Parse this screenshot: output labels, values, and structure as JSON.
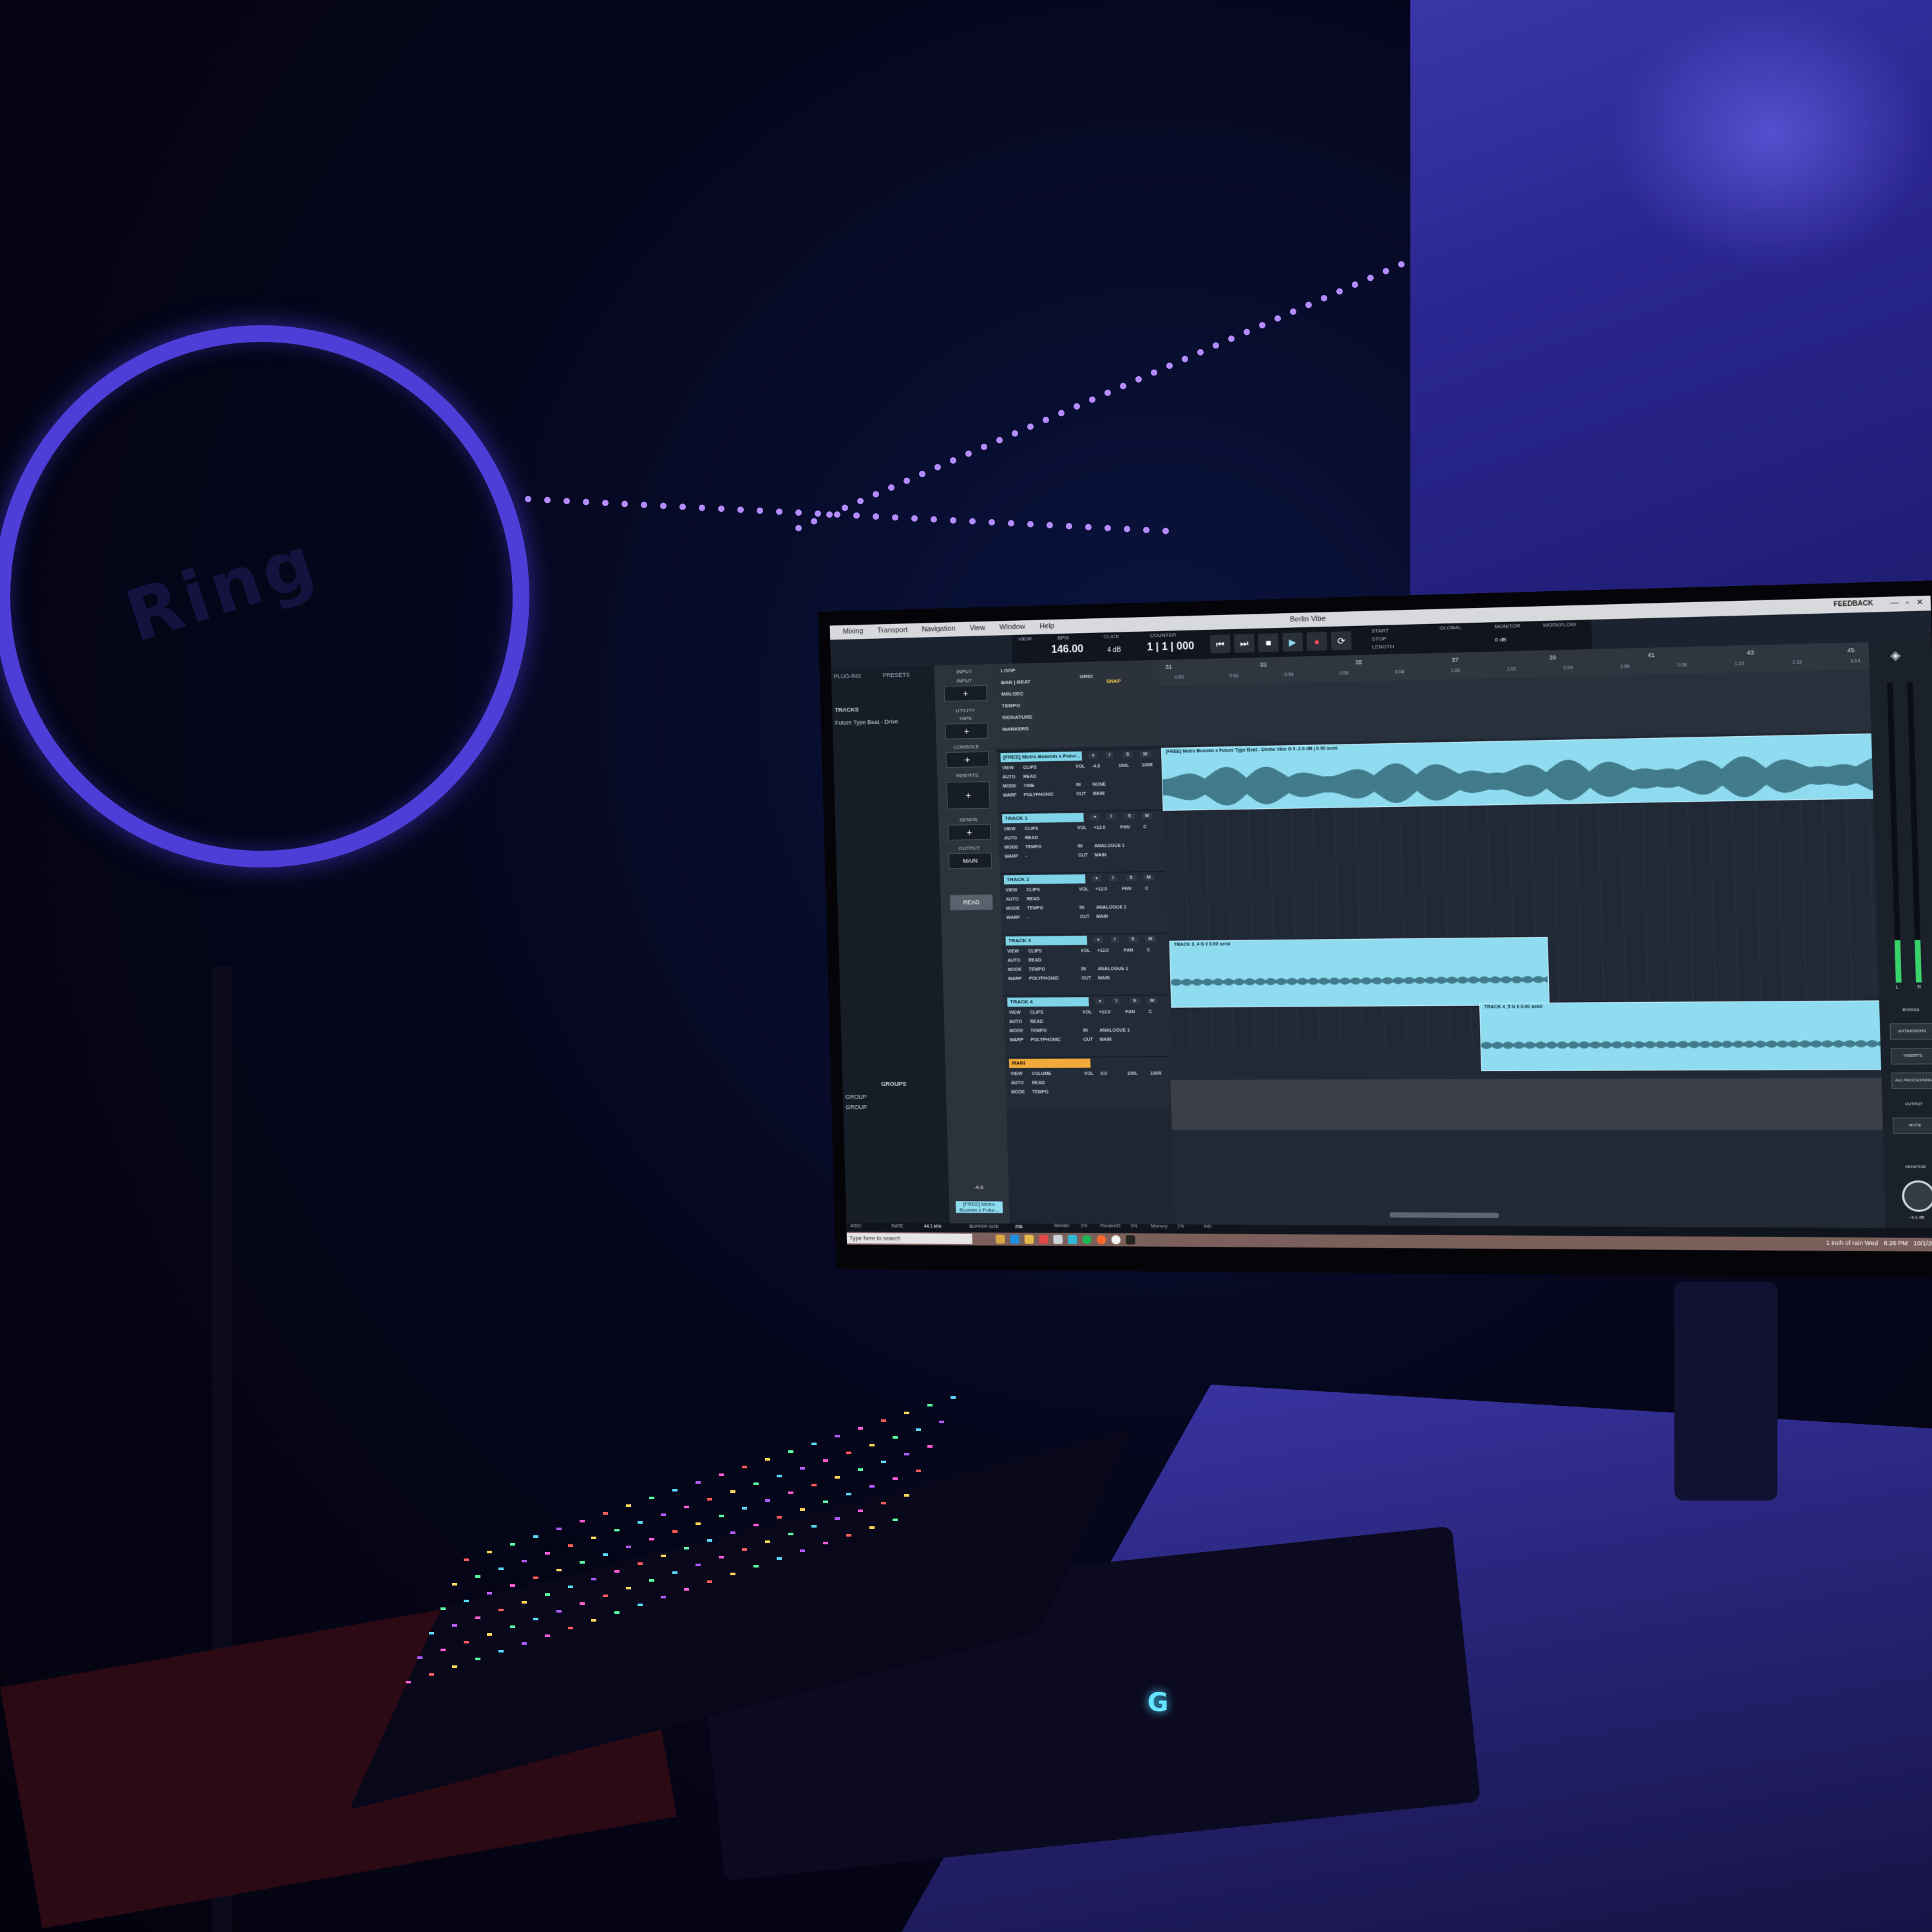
{
  "app": {
    "menus": [
      "Mixing",
      "Transport",
      "Navigation",
      "View",
      "Window",
      "Help"
    ],
    "project_title": "Berlin Vibe",
    "feedback_label": "FEEDBACK",
    "window_controls": [
      "—",
      "▫",
      "✕"
    ]
  },
  "transport": {
    "view_label": "VIEW",
    "bpm_label": "BPM",
    "bpm_value": "146.00",
    "click_label": "CLICK",
    "click_value": "4 dB",
    "counter_label": "COUNTER",
    "counter_value": "1 | 1 | 000",
    "buttons": [
      "⏮",
      "⏭",
      "■",
      "▶",
      "●",
      "⟳"
    ],
    "start_label": "START",
    "stop_label": "STOP",
    "length_label": "LENGTH",
    "global_label": "GLOBAL",
    "monitor_label": "MONITOR",
    "monitor_value": "0 dB",
    "workflow_label": "WORKFLOW"
  },
  "left_panel": {
    "tabs": [
      "PLUG-INS",
      "PRESETS"
    ],
    "section": "TRACKS",
    "item": "Future Type Beat - Drive",
    "groups_label": "GROUPS",
    "group_items": [
      "GROUP",
      "GROUP"
    ]
  },
  "mid_panel": {
    "labels": [
      "INPUT",
      "INPUT",
      "UTILITY",
      "TAPE",
      "CONSOLE",
      "INSERTS",
      "SENDS",
      "OUTPUT"
    ],
    "output_value": "MAIN",
    "read_label": "READ",
    "fader_value": "-4.0",
    "track_tag": "[FREE] Metro Boomin x Futur..."
  },
  "ruler_rows": [
    "LOOP",
    "BAR | BEAT",
    "MIN:SEC",
    "TEMPO",
    "SIGNATURE",
    "MARKERS"
  ],
  "grid": {
    "label": "GRID",
    "snap": "SNAP"
  },
  "bars": [
    "31",
    "33",
    "35",
    "37",
    "39",
    "41",
    "43",
    "45"
  ],
  "times": [
    "0:50",
    "0:52",
    "0:54",
    "0:56",
    "0:58",
    "1:00",
    "1:02",
    "1:04",
    "1:06",
    "1:08",
    "1:10",
    "1:12",
    "1:14"
  ],
  "tracks": [
    {
      "name": "[FREE] Metro Boomin x Futur...",
      "view": "CLIPS",
      "auto": "READ",
      "mode": "TIME",
      "warp": "POLYPHONIC",
      "vol": "-4.0",
      "pan": "100L",
      "pan2": "100R",
      "in": "NONE",
      "out": "MAIN"
    },
    {
      "name": "TRACK 1",
      "view": "CLIPS",
      "auto": "READ",
      "mode": "TEMPO",
      "warp": "-",
      "vol": "+12.0",
      "pan": "PAN",
      "pan2": "C",
      "in": "ANALOGUE 1",
      "out": "MAIN"
    },
    {
      "name": "TRACK 2",
      "view": "CLIPS",
      "auto": "READ",
      "mode": "TEMPO",
      "warp": "-",
      "vol": "+12.0",
      "pan": "PAN",
      "pan2": "C",
      "in": "ANALOGUE 1",
      "out": "MAIN"
    },
    {
      "name": "TRACK 3",
      "view": "CLIPS",
      "auto": "READ",
      "mode": "TEMPO",
      "warp": "POLYPHONIC",
      "vol": "+12.0",
      "pan": "PAN",
      "pan2": "C",
      "in": "ANALOGUE 1",
      "out": "MAIN"
    },
    {
      "name": "TRACK 4",
      "view": "CLIPS",
      "auto": "READ",
      "mode": "TEMPO",
      "warp": "POLYPHONIC",
      "vol": "+12.0",
      "pan": "PAN",
      "pan2": "C",
      "in": "ANALOGUE 1",
      "out": "MAIN"
    }
  ],
  "main_track": {
    "name": "MAIN",
    "view": "VOLUME",
    "auto": "READ",
    "mode": "TEMPO",
    "vol": "0.0",
    "pan": "100L",
    "pan2": "100R"
  },
  "track_buttons": [
    "●",
    "I",
    "S",
    "M"
  ],
  "clips": [
    {
      "label": "[FREE] Metro Boomin x Future Type Beat - Divine Vibe   G  ‖  -2.0 dB  |  0.00 semi"
    },
    {
      "label": "TRACK 3_4   G  ‖  0.00 semi"
    },
    {
      "label": "TRACK 4_5   G  ‖  0.00 semi"
    }
  ],
  "right_panel": {
    "meter_labels": [
      "L",
      "R"
    ],
    "buttons": [
      "BYPASS",
      "EXTENSIONS",
      "INSERTS",
      "ALL PROCESSING",
      "OUTPUT",
      "MUTE"
    ],
    "monitor_label": "MONITOR",
    "monitor_value": "-3.1 dB"
  },
  "status": {
    "format": "ASIO",
    "rate_label": "RATE",
    "rate_value": "44.1 kHz",
    "buffer_label": "BUFFER SIZE",
    "buffer_value": "256",
    "render_label": "Render",
    "render_value": "1%",
    "renderio_label": "RenderIO",
    "renderio_value": "0%",
    "memory_label": "Memory",
    "memory_value": "1%",
    "misc": "Info"
  },
  "taskbar": {
    "search_placeholder": "Type here to search",
    "weather": "1 inch of rain Wed",
    "time": "8:26 PM",
    "date": "10/1/2025"
  },
  "room": {
    "ring_logo_text": "Ring",
    "mouse_logo": "G"
  },
  "colors": {
    "clip": "#8fdcf0",
    "main_track": "#f2a93b",
    "led": "#b58cff",
    "meter": "#38d36a"
  }
}
